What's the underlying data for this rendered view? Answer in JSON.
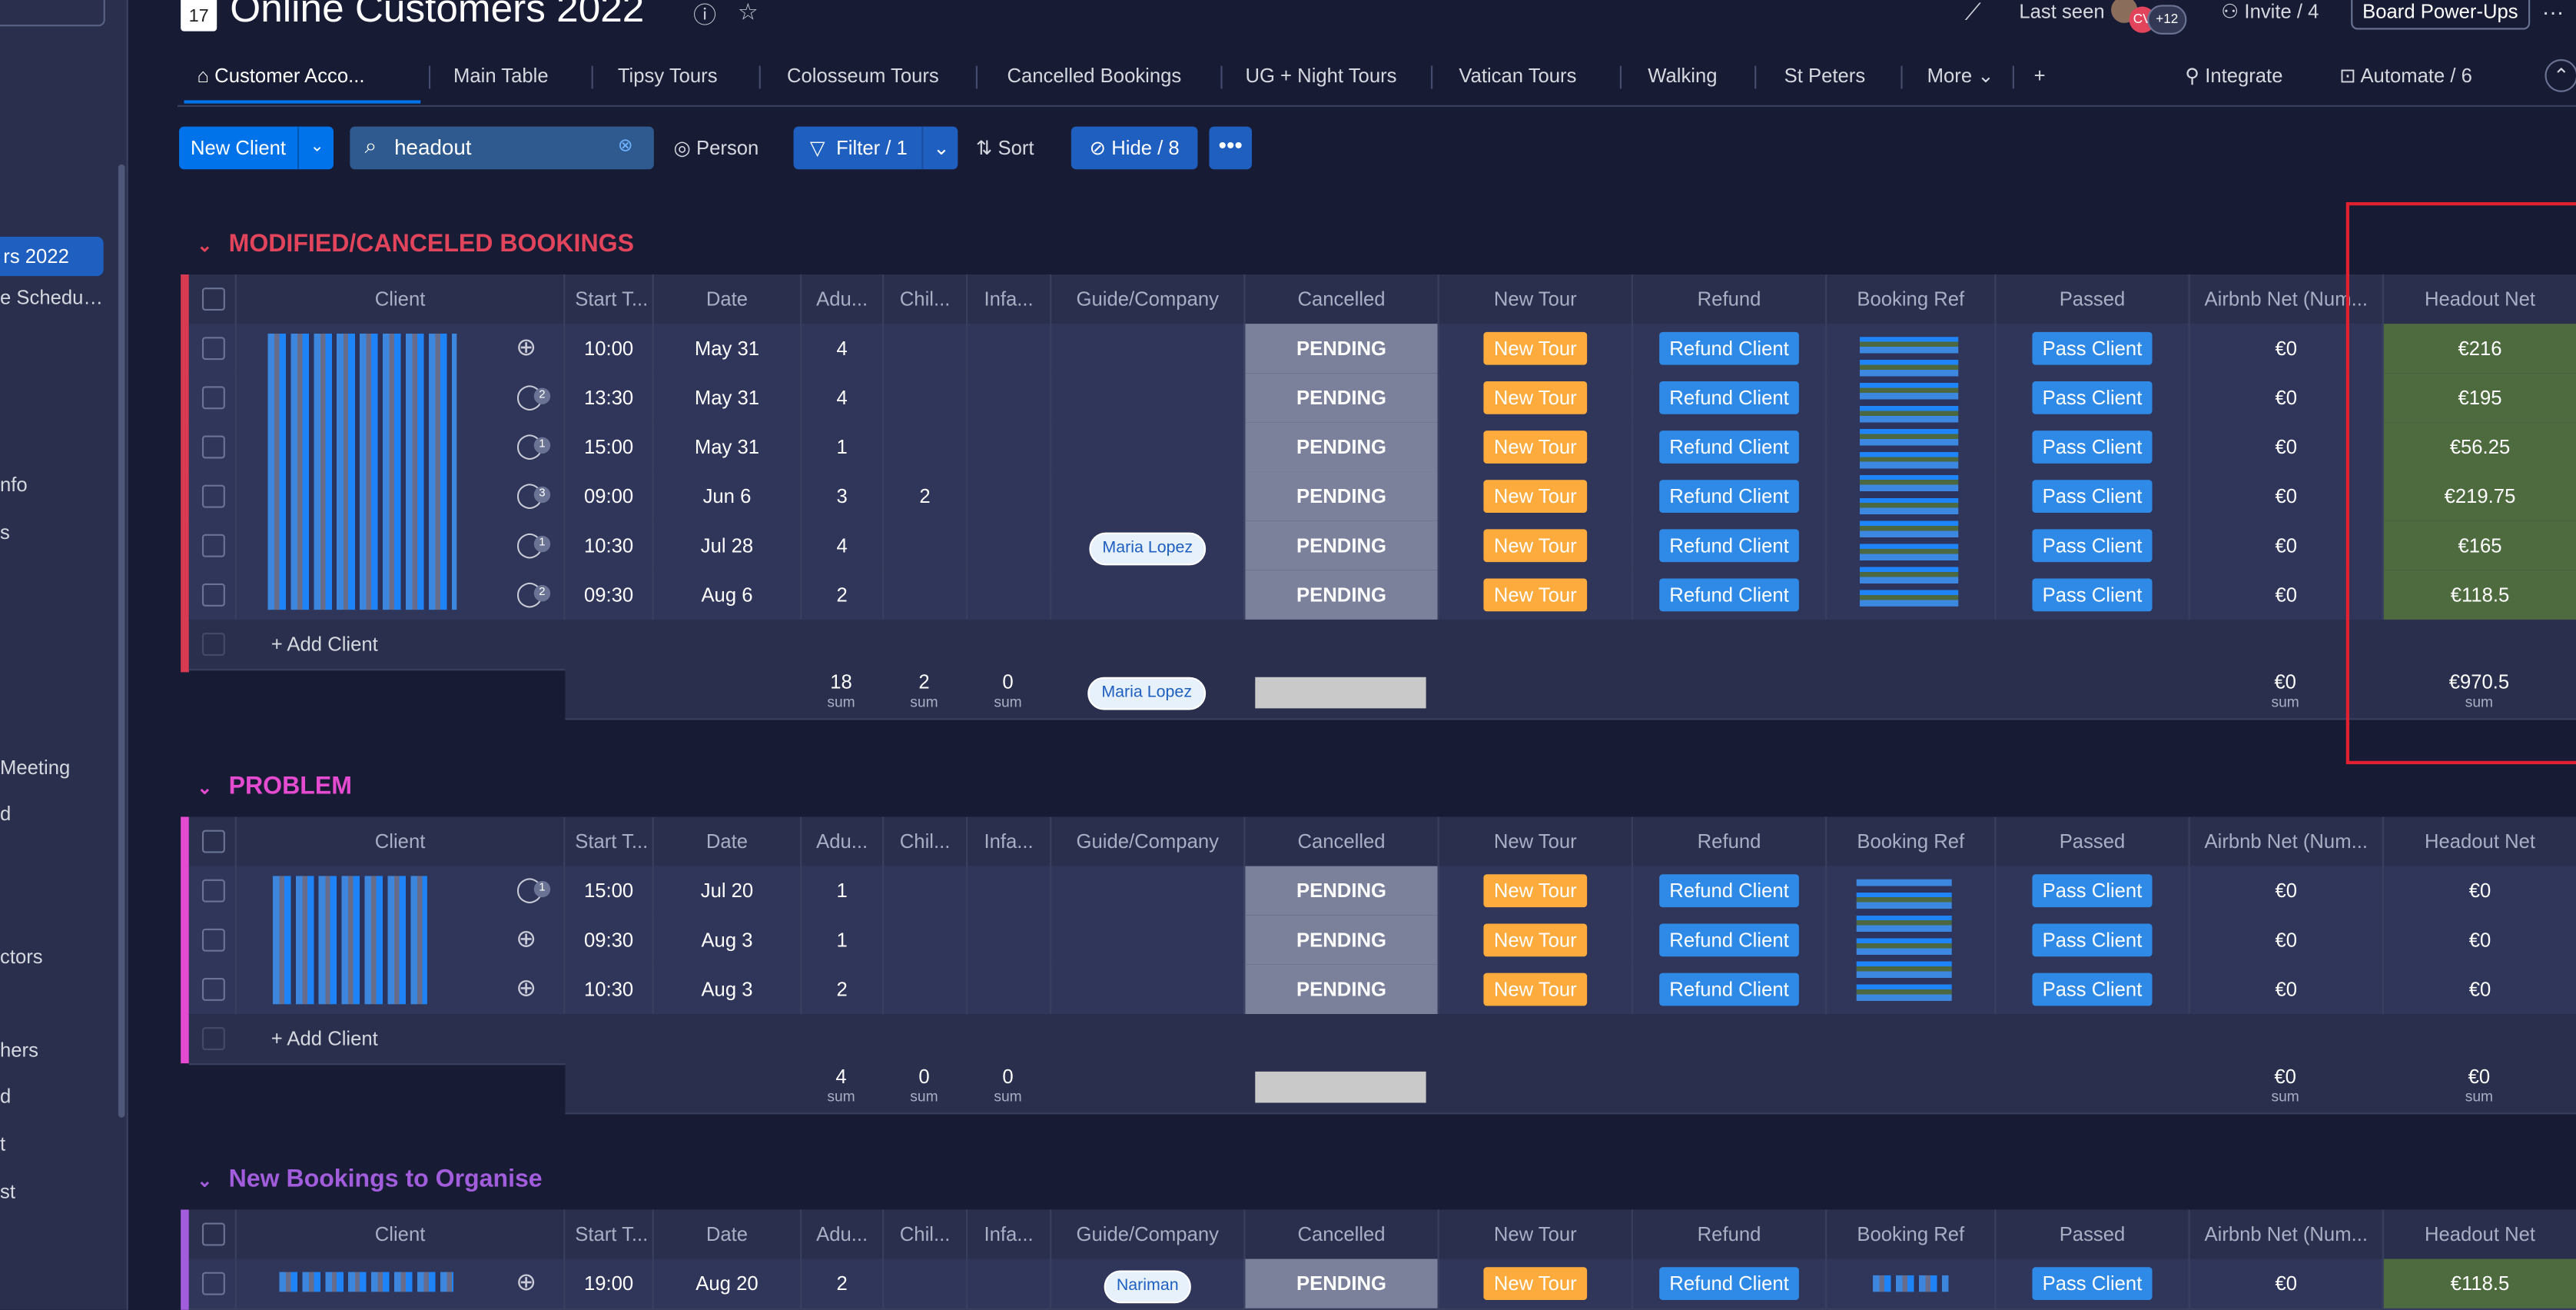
{
  "app": {
    "title": "Online Customers 2022",
    "calendar_day": "17"
  },
  "sidebar": {
    "items": [
      "rs 2022",
      "e Schedu…",
      "nfo",
      "s",
      "Meeting",
      "d",
      "ctors",
      "hers",
      "d",
      "t",
      "st"
    ]
  },
  "header": {
    "last_seen": "Last seen",
    "avatar_initials": "CV",
    "avatar_count": "+12",
    "invite": "Invite / 4",
    "power_ups": "Board Power-Ups",
    "more": "…"
  },
  "tabs": [
    "Customer Acco...",
    "Main Table",
    "Tipsy Tours",
    "Colosseum Tours",
    "Cancelled Bookings",
    "UG + Night Tours",
    "Vatican Tours",
    "Walking",
    "St Peters",
    "More"
  ],
  "tab_actions": {
    "add": "+",
    "integrate": "Integrate",
    "automate": "Automate / 6"
  },
  "toolbar": {
    "new_client": "New Client",
    "search_value": "headout",
    "person": "Person",
    "filter": "Filter / 1",
    "sort": "Sort",
    "hide": "Hide / 8",
    "more": "•••"
  },
  "columns": [
    "Client",
    "Start T...",
    "Date",
    "Adu...",
    "Chil...",
    "Infa...",
    "Guide/Company",
    "Cancelled",
    "New Tour",
    "Refund",
    "Booking Ref",
    "Passed",
    "Airbnb Net (Num...",
    "Headout Net"
  ],
  "labels": {
    "pending": "PENDING",
    "new_tour": "New Tour",
    "refund_client": "Refund Client",
    "pass_client": "Pass Client",
    "add_client": "+ Add Client",
    "sum": "sum"
  },
  "groups": [
    {
      "title": "MODIFIED/CANCELED BOOKINGS",
      "color": "#d83a52",
      "rows": [
        {
          "start": "10:00",
          "date": "May 31",
          "adults": "4",
          "children": "",
          "infants": "",
          "guide": "",
          "airbnb": "€0",
          "headout": "€216",
          "updates": ""
        },
        {
          "start": "13:30",
          "date": "May 31",
          "adults": "4",
          "children": "",
          "infants": "",
          "guide": "",
          "airbnb": "€0",
          "headout": "€195",
          "updates": "2"
        },
        {
          "start": "15:00",
          "date": "May 31",
          "adults": "1",
          "children": "",
          "infants": "",
          "guide": "",
          "airbnb": "€0",
          "headout": "€56.25",
          "updates": "1"
        },
        {
          "start": "09:00",
          "date": "Jun 6",
          "adults": "3",
          "children": "2",
          "infants": "",
          "guide": "",
          "airbnb": "€0",
          "headout": "€219.75",
          "updates": "3"
        },
        {
          "start": "10:30",
          "date": "Jul 28",
          "adults": "4",
          "children": "",
          "infants": "",
          "guide": "Maria Lopez",
          "airbnb": "€0",
          "headout": "€165",
          "updates": "1"
        },
        {
          "start": "09:30",
          "date": "Aug 6",
          "adults": "2",
          "children": "",
          "infants": "",
          "guide": "",
          "airbnb": "€0",
          "headout": "€118.5",
          "updates": "2"
        }
      ],
      "sums": {
        "adults": "18",
        "children": "2",
        "infants": "0",
        "guide": "Maria Lopez",
        "airbnb": "€0",
        "headout": "€970.5"
      }
    },
    {
      "title": "PROBLEM",
      "color": "#e44bd0",
      "rows": [
        {
          "start": "15:00",
          "date": "Jul 20",
          "adults": "1",
          "children": "",
          "infants": "",
          "guide": "",
          "airbnb": "€0",
          "headout": "€0",
          "updates": "1"
        },
        {
          "start": "09:30",
          "date": "Aug 3",
          "adults": "1",
          "children": "",
          "infants": "",
          "guide": "",
          "airbnb": "€0",
          "headout": "€0",
          "updates": ""
        },
        {
          "start": "10:30",
          "date": "Aug 3",
          "adults": "2",
          "children": "",
          "infants": "",
          "guide": "",
          "airbnb": "€0",
          "headout": "€0",
          "updates": ""
        }
      ],
      "sums": {
        "adults": "4",
        "children": "0",
        "infants": "0",
        "guide": "",
        "airbnb": "€0",
        "headout": "€0"
      }
    },
    {
      "title": "New Bookings to Organise",
      "color": "#a25ddc",
      "rows": [
        {
          "start": "19:00",
          "date": "Aug 20",
          "adults": "2",
          "children": "",
          "infants": "",
          "guide": "Nariman",
          "airbnb": "€0",
          "headout": "€118.5",
          "updates": ""
        }
      ]
    }
  ]
}
